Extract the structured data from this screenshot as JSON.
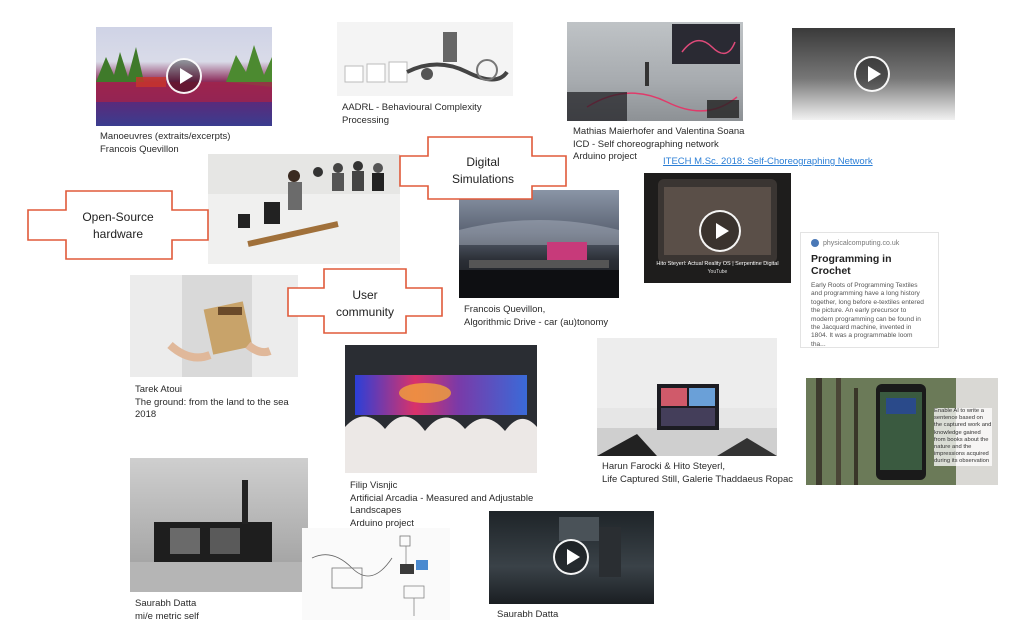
{
  "captions": {
    "manoeuvres": [
      "Manoeuvres (extraits/excerpts)",
      "Francois Quevillon"
    ],
    "aadrl": [
      "AADRL - Behavioural Complexity",
      "Processing"
    ],
    "mathias": [
      "Mathias Maierhofer and Valentina Soana",
      "ICD - Self choreographing network",
      "Arduino project"
    ],
    "algorithmic": [
      "Francois Quevillon,",
      "Algorithmic Drive - car (au)tonomy"
    ],
    "tarek": [
      "Tarek Atoui",
      "The ground: from the land to the sea",
      "2018"
    ],
    "filip": [
      "Filip Visnjic",
      "Artificial Arcadia - Measured and Adjustable",
      "Landscapes",
      "Arduino project"
    ],
    "harun": [
      "Harun Farocki & Hito Steyerl,",
      "Life Captured Still, Galerie Thaddaeus Ropac"
    ],
    "saurabh_left": [
      "Saurabh Datta",
      "mi/e metric self"
    ],
    "saurabh_bottom": [
      "Saurabh Datta"
    ]
  },
  "labels": {
    "digital": [
      "Digital",
      "Simulations"
    ],
    "opensource": [
      "Open-Source",
      "hardware"
    ],
    "user": [
      "User",
      "community"
    ]
  },
  "link_itech": "ITECH M.Sc. 2018: Self-Choreographing Network",
  "hito_video": {
    "title": "Hito Steyerl: Actual Reality OS | Serpentine Digital",
    "source": "YouTube"
  },
  "card": {
    "site": "physicalcomputing.co.uk",
    "title": "Programming in Crochet",
    "body": "Early Roots of Programming Textiles and programming have a long history together, long before e-textiles entered the picture. An early precursor to modern programming can be found in the Jacquard machine, invented in 1804. It was a programmable loom tha..."
  },
  "phone_text": "Enable AI to write a sentence based on the captured work and knowledge gained from books about the nature and the impressions acquired during its observation",
  "colors": {
    "label_border": "#e05a3a",
    "link": "#2c7fd6"
  }
}
